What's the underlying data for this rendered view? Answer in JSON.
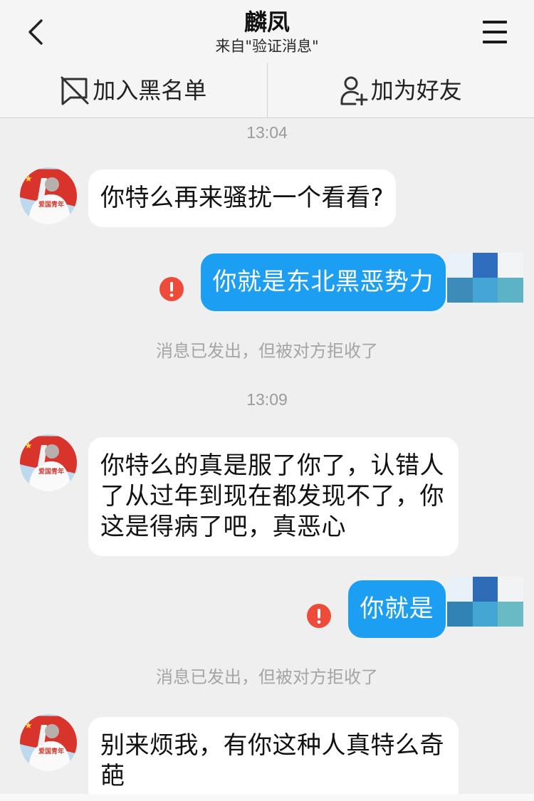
{
  "header": {
    "back_icon": "chevron-left-icon",
    "title": "麟凤",
    "subtitle": "来自\"验证消息\"",
    "menu_icon": "hamburger-menu-icon"
  },
  "action_bar": {
    "block": {
      "icon": "block-flag-icon",
      "label": "加入黑名单"
    },
    "add_friend": {
      "icon": "add-person-icon",
      "label": "加为好友"
    }
  },
  "avatar": {
    "caption": "爱国青年"
  },
  "chat": {
    "timestamps": [
      "13:04",
      "13:09"
    ],
    "incoming_messages": [
      "你特么再来骚扰一个看看?",
      "你特么的真是服了你了，认错人了从过年到现在都发现不了，你这是得病了吧，真恶心",
      "别来烦我，有你这种人真特么奇葩"
    ],
    "outgoing_messages": [
      {
        "text": "你就是东北黑恶势力",
        "status_icon": "error-exclamation-icon"
      },
      {
        "text": "你就是",
        "status_icon": "error-exclamation-icon"
      }
    ],
    "rejection_notices": [
      "消息已发出，但被对方拒收了",
      "消息已发出，但被对方拒收了"
    ]
  },
  "colors": {
    "outgoing_bubble": "#1c9ef3",
    "incoming_bubble": "#ffffff",
    "error_badge": "#ef4b3a",
    "chat_background": "#efefef"
  }
}
